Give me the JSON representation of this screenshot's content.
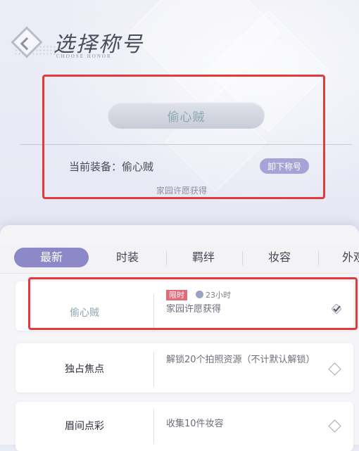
{
  "header": {
    "title": "选择称号",
    "subtitle": "CHOOSE HONOR"
  },
  "preview": {
    "title_name": "偷心贼",
    "current_label": "当前装备：偷心贼",
    "unequip_label": "卸下称号",
    "source": "家园许愿获得"
  },
  "tabs": [
    {
      "label": "最新",
      "active": true
    },
    {
      "label": "时装",
      "active": false
    },
    {
      "label": "羁绊",
      "active": false
    },
    {
      "label": "妆容",
      "active": false
    },
    {
      "label": "外观",
      "active": false
    }
  ],
  "titles_list": [
    {
      "name": "偷心贼",
      "badge": "限时",
      "timer": "23小时",
      "desc": "家园许愿获得",
      "equipped": true,
      "name_color": "#8aa6b0"
    },
    {
      "name": "独占焦点",
      "desc": "解锁20个拍照资源（不计默认解锁）",
      "equipped": false
    },
    {
      "name": "眉间点彩",
      "desc": "收集10件妆容",
      "equipped": false
    }
  ],
  "colors": {
    "accent": "#8d88c8",
    "limited_badge": "#e26a7b",
    "highlight_box": "#e23b3b"
  }
}
